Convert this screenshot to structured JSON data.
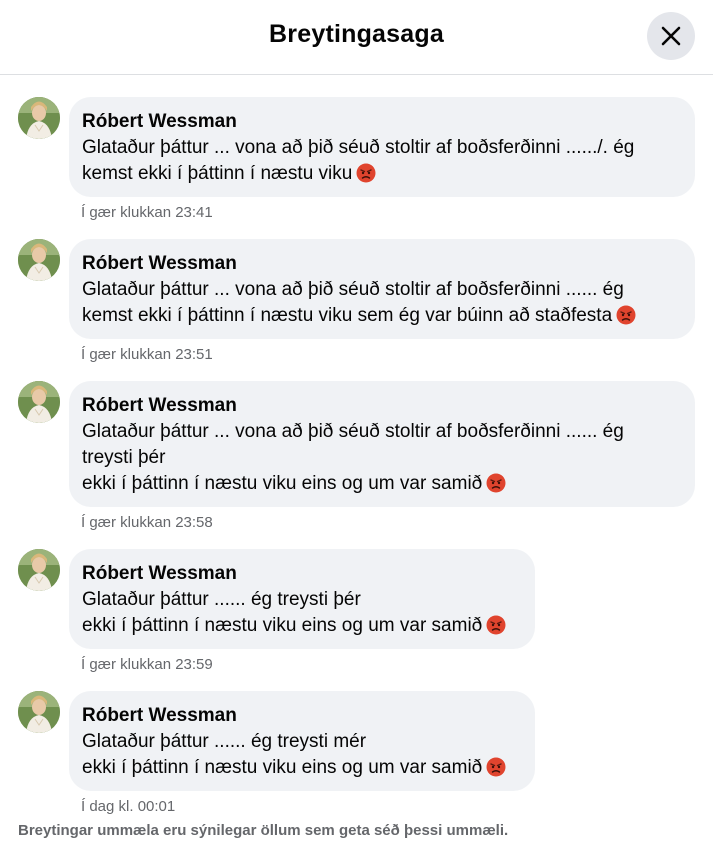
{
  "dialog": {
    "title": "Breytingasaga",
    "close_icon": "close-icon"
  },
  "edits": [
    {
      "author": "Róbert Wessman",
      "text": "Glataður þáttur ... vona að þið séuð stoltir af boðsferðinni ....../. ég\nkemst ekki í þáttinn í næstu viku",
      "emoji": "angry-face-emoji",
      "time": "Í gær klukkan 23:41"
    },
    {
      "author": "Róbert Wessman",
      "text": "Glataður þáttur ... vona að þið séuð stoltir af boðsferðinni ...... ég\nkemst ekki í þáttinn í næstu viku sem ég var búinn að staðfesta",
      "emoji": "angry-face-emoji",
      "time": "Í gær klukkan 23:51"
    },
    {
      "author": "Róbert Wessman",
      "text": "Glataður þáttur ... vona að þið séuð stoltir af boðsferðinni ...... ég\ntreysti þér\nekki í þáttinn í næstu viku eins og um var samið",
      "emoji": "angry-face-emoji",
      "time": "Í gær klukkan 23:58"
    },
    {
      "author": "Róbert Wessman",
      "text": "Glataður þáttur ...... ég treysti þér\nekki í þáttinn í næstu viku eins og um var samið",
      "emoji": "angry-face-emoji",
      "time": "Í gær klukkan 23:59"
    },
    {
      "author": "Róbert Wessman",
      "text": "Glataður þáttur ...... ég treysti mér\nekki í þáttinn í næstu viku eins og um var samið",
      "emoji": "angry-face-emoji",
      "time": "Í dag kl. 00:01"
    }
  ],
  "footer": {
    "note": "Breytingar ummæla eru sýnilegar öllum sem geta séð þessi ummæli."
  },
  "colors": {
    "bubble_bg": "#f0f2f5",
    "secondary_text": "#65676b",
    "close_bg": "#e4e6eb",
    "emoji_face": "#e0442e"
  }
}
